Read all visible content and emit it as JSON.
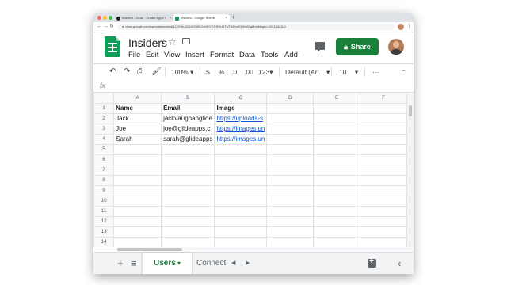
{
  "browser": {
    "tabs": [
      {
        "title": "Insiders - Glide - Create Apps f",
        "active": false
      },
      {
        "title": "Insiders - Google Sheets",
        "active": true
      }
    ],
    "new_tab": "+",
    "close": "×",
    "url": "docs.google.com/spreadsheets/d/1C(K9b-GOIUIGXfU2zHEVCRSHU6TUT65Yc6QWd82gM/edit#gid=1021344341"
  },
  "document": {
    "title": "Insiders",
    "menu": [
      "File",
      "Edit",
      "View",
      "Insert",
      "Format",
      "Data",
      "Tools",
      "Add-"
    ],
    "share_label": "Share"
  },
  "toolbar": {
    "zoom": "100%",
    "currency": "$",
    "percent": "%",
    "dec_less": ".0",
    "dec_more": ".00",
    "more_formats": "123",
    "font": "Default (Ari...",
    "font_size": "10",
    "more": "···"
  },
  "formula_bar": {
    "fx": "fx"
  },
  "grid": {
    "columns": [
      "A",
      "B",
      "C",
      "D",
      "E",
      "F"
    ],
    "rows": [
      {
        "n": "1",
        "cells": [
          "Name",
          "Email",
          "Image"
        ]
      },
      {
        "n": "2",
        "cells": [
          "Jack",
          "jackvaughanglide",
          "https://uploads-s"
        ]
      },
      {
        "n": "3",
        "cells": [
          "Joe",
          "joe@glideapps.c",
          "https://images.un"
        ]
      },
      {
        "n": "4",
        "cells": [
          "Sarah",
          "sarah@glideapps",
          "https://images.un"
        ]
      },
      {
        "n": "5",
        "cells": [
          "",
          "",
          ""
        ]
      },
      {
        "n": "6",
        "cells": [
          "",
          "",
          ""
        ]
      },
      {
        "n": "7",
        "cells": [
          "",
          "",
          ""
        ]
      },
      {
        "n": "8",
        "cells": [
          "",
          "",
          ""
        ]
      },
      {
        "n": "9",
        "cells": [
          "",
          "",
          ""
        ]
      },
      {
        "n": "10",
        "cells": [
          "",
          "",
          ""
        ]
      },
      {
        "n": "11",
        "cells": [
          "",
          "",
          ""
        ]
      },
      {
        "n": "12",
        "cells": [
          "",
          "",
          ""
        ]
      },
      {
        "n": "13",
        "cells": [
          "",
          "",
          ""
        ]
      },
      {
        "n": "14",
        "cells": [
          "",
          "",
          ""
        ]
      }
    ]
  },
  "sheets": {
    "add": "+",
    "list": "≡",
    "active": "Users",
    "other": "Connect",
    "prev": "◀",
    "next": "▶",
    "collapse": "‹"
  }
}
